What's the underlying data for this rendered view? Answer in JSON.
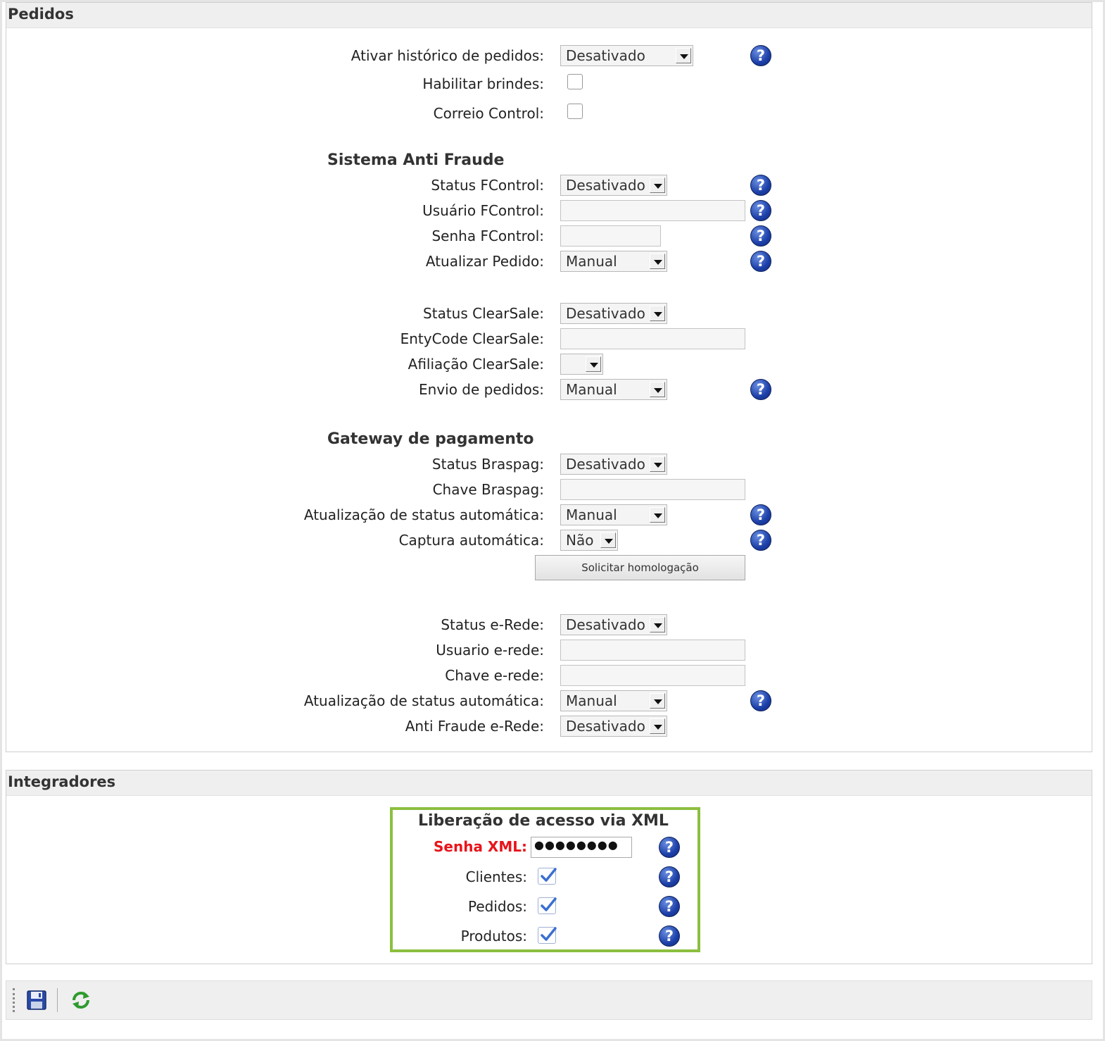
{
  "pedidos": {
    "title": "Pedidos",
    "historico_label": "Ativar histórico de pedidos:",
    "historico_value": "Desativado",
    "brindes_label": "Habilitar brindes:",
    "correio_label": "Correio Control:",
    "anti_fraude_heading": "Sistema Anti Fraude",
    "fcontrol_status_label": "Status FControl:",
    "fcontrol_status_value": "Desativado",
    "fcontrol_user_label": "Usuário FControl:",
    "fcontrol_pass_label": "Senha FControl:",
    "atualizar_pedido_label": "Atualizar Pedido:",
    "atualizar_pedido_value": "Manual",
    "clearsale_status_label": "Status ClearSale:",
    "clearsale_status_value": "Desativado",
    "clearsale_entycode_label": "EntyCode ClearSale:",
    "clearsale_afiliacao_label": "Afiliação ClearSale:",
    "envio_label": "Envio de pedidos:",
    "envio_value": "Manual",
    "gateway_heading": "Gateway de pagamento",
    "braspag_status_label": "Status Braspag:",
    "braspag_status_value": "Desativado",
    "braspag_key_label": "Chave Braspag:",
    "braspag_auto_label": "Atualização de status automática:",
    "braspag_auto_value": "Manual",
    "captura_label": "Captura automática:",
    "captura_value": "Não",
    "homologacao_button": "Solicitar homologação",
    "erede_status_label": "Status e-Rede:",
    "erede_status_value": "Desativado",
    "erede_user_label": "Usuario e-rede:",
    "erede_key_label": "Chave e-rede:",
    "erede_auto_label": "Atualização de status automática:",
    "erede_auto_value": "Manual",
    "erede_antifraude_label": "Anti Fraude e-Rede:",
    "erede_antifraude_value": "Desativado"
  },
  "integradores": {
    "title": "Integradores",
    "xml_heading": "Liberação de acesso via XML",
    "senha_label": "Senha XML:",
    "senha_value": "●●●●●●●●",
    "clientes_label": "Clientes:",
    "pedidos_label": "Pedidos:",
    "produtos_label": "Produtos:",
    "clientes_checked": true,
    "pedidos_checked": true,
    "produtos_checked": true
  },
  "help_icon_glyph": "?",
  "colors": {
    "highlight_border": "#8cbf3f",
    "required_label": "#e8141a",
    "help_icon": "#1c3fa8"
  }
}
